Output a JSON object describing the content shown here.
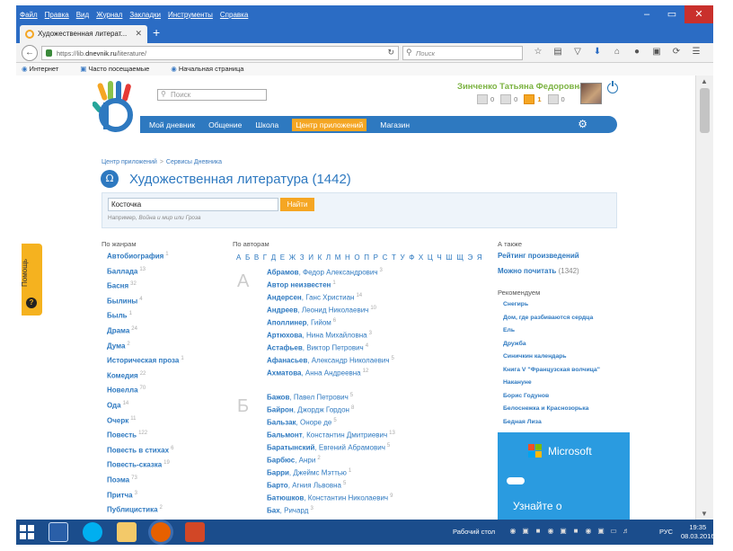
{
  "menubar": {
    "items": [
      "Файл",
      "Правка",
      "Вид",
      "Журнал",
      "Закладки",
      "Инструменты",
      "Справка"
    ]
  },
  "window_controls": {
    "minimize": "–",
    "maximize": "▭",
    "close": "✕"
  },
  "tab": {
    "title": "Художественная литерат...",
    "close": "✕",
    "new_tab": "+"
  },
  "navbar": {
    "url_scheme": "https://lib.",
    "url_host": "dnevnik.ru",
    "url_path": "/literature/",
    "search_placeholder": "Поиск",
    "icons": [
      "star-icon",
      "clipboard-icon",
      "pocket-icon",
      "download-icon",
      "home-icon",
      "chat-icon",
      "screenshot-icon",
      "sync-icon",
      "menu-icon"
    ]
  },
  "bookmarks": [
    "Интернет",
    "Часто посещаемые",
    "Начальная страница"
  ],
  "header": {
    "search_placeholder": "Поиск",
    "user_name": "Зинченко Татьяна Федоровна",
    "counters": [
      {
        "icon": "mail-icon",
        "value": "0"
      },
      {
        "icon": "friends-icon",
        "value": "0"
      },
      {
        "icon": "notifications-icon",
        "value": "1",
        "highlight": true
      },
      {
        "icon": "events-icon",
        "value": "0"
      }
    ]
  },
  "mainnav": {
    "items": [
      "Мой дневник",
      "Общение",
      "Школа",
      "Центр приложений",
      "Магазин"
    ],
    "active": "Центр приложений"
  },
  "breadcrumb": {
    "items": [
      "Центр приложений",
      "Сервисы Дневника"
    ],
    "separator": ">"
  },
  "page_title": "Художественная литература (1442)",
  "search": {
    "value": "Косточка",
    "button": "Найти",
    "hint_prefix": "Например, ",
    "hint_example": "Война и мир или Гроза"
  },
  "columns": {
    "genres": "По жанрам",
    "authors": "По авторам",
    "also": "А также"
  },
  "genres": [
    {
      "name": "Автобиография",
      "count": "1"
    },
    {
      "name": "Баллада",
      "count": "13"
    },
    {
      "name": "Басня",
      "count": "32"
    },
    {
      "name": "Былины",
      "count": "4"
    },
    {
      "name": "Быль",
      "count": "1"
    },
    {
      "name": "Драма",
      "count": "24"
    },
    {
      "name": "Дума",
      "count": "2"
    },
    {
      "name": "Историческая проза",
      "count": "1"
    },
    {
      "name": "Комедия",
      "count": "22"
    },
    {
      "name": "Новелла",
      "count": "70"
    },
    {
      "name": "Ода",
      "count": "14"
    },
    {
      "name": "Очерк",
      "count": "11"
    },
    {
      "name": "Повесть",
      "count": "122"
    },
    {
      "name": "Повесть в стихах",
      "count": "6"
    },
    {
      "name": "Повесть-сказка",
      "count": "19"
    },
    {
      "name": "Поэма",
      "count": "73"
    },
    {
      "name": "Притча",
      "count": "3"
    },
    {
      "name": "Публицистика",
      "count": "2"
    }
  ],
  "alphabet": "А Б В Г Д Е Ж З И К Л М Н О П Р С Т У Ф Х Ц Ч Ш Щ Э Я",
  "author_groups": [
    {
      "letter": "А",
      "authors": [
        {
          "surname": "Абрамов",
          "rest": ", Федор Александрович",
          "count": "3"
        },
        {
          "surname": "Автор неизвестен",
          "rest": "",
          "count": "1"
        },
        {
          "surname": "Андерсен",
          "rest": ", Ганс Христиан",
          "count": "14"
        },
        {
          "surname": "Андреев",
          "rest": ", Леонид Николаевич",
          "count": "10"
        },
        {
          "surname": "Аполлинер",
          "rest": ", Гийом",
          "count": "6"
        },
        {
          "surname": "Артюхова",
          "rest": ", Нина Михайловна",
          "count": "3"
        },
        {
          "surname": "Астафьев",
          "rest": ", Виктор Петрович",
          "count": "4"
        },
        {
          "surname": "Афанасьев",
          "rest": ", Александр Николаевич",
          "count": "5"
        },
        {
          "surname": "Ахматова",
          "rest": ", Анна Андреевна",
          "count": "12"
        }
      ]
    },
    {
      "letter": "Б",
      "authors": [
        {
          "surname": "Бажов",
          "rest": ", Павел Петрович",
          "count": "5"
        },
        {
          "surname": "Байрон",
          "rest": ", Джордж Гордон",
          "count": "8"
        },
        {
          "surname": "Бальзак",
          "rest": ", Оноре де",
          "count": "5"
        },
        {
          "surname": "Бальмонт",
          "rest": ", Константин Дмитриевич",
          "count": "13"
        },
        {
          "surname": "Баратынский",
          "rest": ", Евгений Абрамович",
          "count": "5"
        },
        {
          "surname": "Барбюс",
          "rest": ", Анри",
          "count": "2"
        },
        {
          "surname": "Барри",
          "rest": ", Джеймс Мэттью",
          "count": "1"
        },
        {
          "surname": "Барто",
          "rest": ", Агния Львовна",
          "count": "5"
        },
        {
          "surname": "Батюшков",
          "rest": ", Константин Николаевич",
          "count": "9"
        },
        {
          "surname": "Бах",
          "rest": ", Ричард",
          "count": "3"
        }
      ]
    }
  ],
  "also_links": [
    {
      "label": "Рейтинг произведений",
      "count": ""
    },
    {
      "label": "Можно почитать",
      "count": "(1342)"
    }
  ],
  "recommend_heading": "Рекомендуем",
  "recommendations": [
    "Снегирь",
    "Дом, где разбиваются сердца",
    "Ель",
    "Дружба",
    "Синичкин календарь",
    "Книга V \"Французская волчица\"",
    "Накануне",
    "Борис Годунов",
    "Белоснежка и Краснозорька",
    "Бедная Лиза"
  ],
  "ad": {
    "brand": "Microsoft",
    "text": "Узнайте о"
  },
  "help_tab": {
    "label": "Помощь",
    "icon": "?"
  },
  "taskbar": {
    "desktop_label": "Рабочий стол",
    "language": "РУС",
    "time": "19:35",
    "date": "08.03.2016"
  }
}
